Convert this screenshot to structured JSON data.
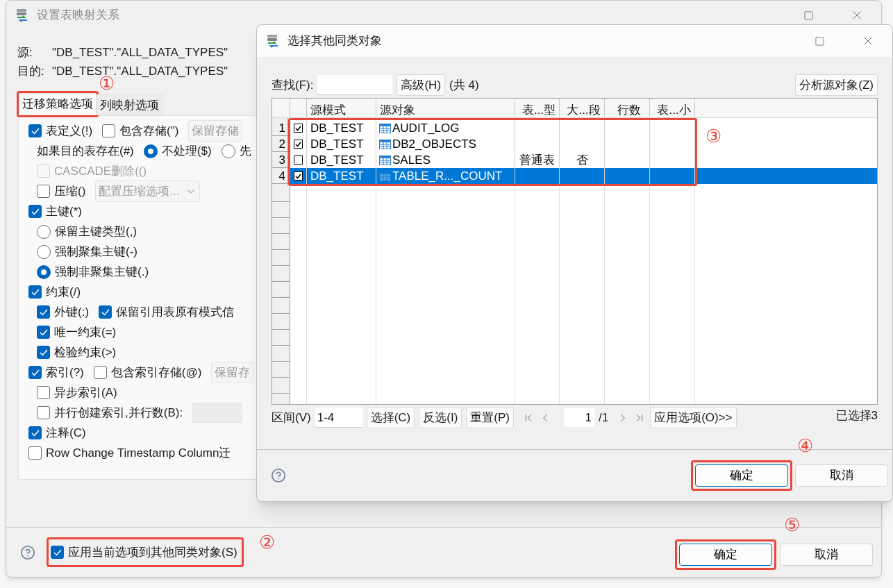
{
  "main_window": {
    "title": "设置表映射关系",
    "source_label": "源:",
    "source_value": "\"DB_TEST\".\"ALL_DATA_TYPES\"",
    "target_label": "目的:",
    "target_value": "\"DB_TEST\".\"ALL_DATA_TYPES\"",
    "tabs_callout": "①",
    "tabs": [
      {
        "label": "迁移策略选项",
        "selected": true
      },
      {
        "label": "列映射选项",
        "selected": false
      }
    ],
    "option_rows": [
      {
        "kind": "top",
        "items": [
          {
            "kind": "checkbox",
            "label": "表定义(!)",
            "checked": true,
            "disabled": false
          },
          {
            "kind": "checkbox",
            "label": "包含存储(\")",
            "checked": false,
            "disabled": false
          },
          {
            "kind": "select",
            "value": "保留存储",
            "disabled": true
          }
        ]
      },
      {
        "kind": "sub",
        "items": [
          {
            "kind": "text",
            "label": "如果目的表存在(#)"
          },
          {
            "kind": "radio",
            "label": "不处理($)",
            "selected": true
          },
          {
            "kind": "radio",
            "label": "先",
            "selected": false
          }
        ]
      },
      {
        "kind": "sub",
        "items": [
          {
            "kind": "checkbox",
            "label": "CASCADE删除(()",
            "checked": false,
            "disabled": true
          }
        ]
      },
      {
        "kind": "sub",
        "items": [
          {
            "kind": "checkbox",
            "label": "压缩()",
            "checked": false,
            "disabled": false
          },
          {
            "kind": "select",
            "value": "配置压缩选项...",
            "disabled": true,
            "caret": true
          }
        ]
      },
      {
        "kind": "top",
        "items": [
          {
            "kind": "checkbox",
            "label": "主键(*)",
            "checked": true,
            "disabled": false
          }
        ]
      },
      {
        "kind": "sub",
        "items": [
          {
            "kind": "radio",
            "label": "保留主键类型(,)",
            "selected": false
          }
        ]
      },
      {
        "kind": "sub",
        "items": [
          {
            "kind": "radio",
            "label": "强制聚集主键(-)",
            "selected": false
          }
        ]
      },
      {
        "kind": "sub",
        "items": [
          {
            "kind": "radio",
            "label": "强制非聚集主键(.)",
            "selected": true
          }
        ]
      },
      {
        "kind": "top",
        "items": [
          {
            "kind": "checkbox",
            "label": "约束(/)",
            "checked": true,
            "disabled": false
          }
        ]
      },
      {
        "kind": "sub",
        "items": [
          {
            "kind": "checkbox",
            "label": "外键(:)",
            "checked": true,
            "disabled": false
          },
          {
            "kind": "checkbox",
            "label": "保留引用表原有模式信",
            "checked": true,
            "disabled": false
          }
        ]
      },
      {
        "kind": "sub",
        "items": [
          {
            "kind": "checkbox",
            "label": "唯一约束(=)",
            "checked": true,
            "disabled": false
          }
        ]
      },
      {
        "kind": "sub",
        "items": [
          {
            "kind": "checkbox",
            "label": "检验约束(>)",
            "checked": true,
            "disabled": false
          }
        ]
      },
      {
        "kind": "top",
        "items": [
          {
            "kind": "checkbox",
            "label": "索引(?)",
            "checked": true,
            "disabled": false
          },
          {
            "kind": "checkbox",
            "label": "包含索引存储(@)",
            "checked": false,
            "disabled": false
          },
          {
            "kind": "select",
            "value": "保留存",
            "disabled": true
          }
        ]
      },
      {
        "kind": "sub",
        "items": [
          {
            "kind": "checkbox",
            "label": "异步索引(A)",
            "checked": false,
            "disabled": false
          }
        ]
      },
      {
        "kind": "sub",
        "items": [
          {
            "kind": "checkbox",
            "label": "并行创建索引,并行数(B):",
            "checked": false,
            "disabled": false
          },
          {
            "kind": "field",
            "disabled": true
          }
        ]
      },
      {
        "kind": "top",
        "items": [
          {
            "kind": "checkbox",
            "label": "注释(C)",
            "checked": true,
            "disabled": false
          }
        ]
      },
      {
        "kind": "top",
        "items": [
          {
            "kind": "checkbox",
            "label": "Row Change Timestamp Column迁",
            "checked": false,
            "disabled": false
          }
        ]
      }
    ],
    "apply_option": {
      "label": "应用当前选项到其他同类对象(S)",
      "checked": true,
      "callout": "②"
    },
    "buttons": [
      {
        "label": "确定",
        "default": true,
        "callout": "⑤"
      },
      {
        "label": "取消",
        "default": false
      }
    ]
  },
  "dialog": {
    "title": "选择其他同类对象",
    "find_label": "查找(F):",
    "advanced_button": "高级(H)",
    "total": "(共 4)",
    "analyze_button": "分析源对象(Z)",
    "table": {
      "callout": "③",
      "columns": [
        "源模式",
        "源对象",
        "表...型",
        "大...段",
        "行数",
        "表...小"
      ],
      "rows": [
        {
          "number": "1",
          "checked": true,
          "selected": false,
          "schema": "DB_TEST",
          "object": "AUDIT_LOG",
          "column_3": "",
          "column_4": ""
        },
        {
          "number": "2",
          "checked": true,
          "selected": false,
          "schema": "DB_TEST",
          "object": "DB2_OBJECTS",
          "column_3": "",
          "column_4": ""
        },
        {
          "number": "3",
          "checked": false,
          "selected": false,
          "schema": "DB_TEST",
          "object": "SALES",
          "column_3": "普通表",
          "column_4": "否"
        },
        {
          "number": "4",
          "checked": true,
          "selected": true,
          "schema": "DB_TEST",
          "object": "TABLE_R..._COUNT",
          "column_3": "",
          "column_4": ""
        }
      ]
    },
    "range_label": "区间(V)",
    "range_value": "1-4",
    "action_buttons": [
      "选择(C)",
      "反选(I)",
      "重置(P)"
    ],
    "page_value": "1",
    "page_total": "/1",
    "apply_options_button": "应用选项(O)>>",
    "selected_count": "已选择3",
    "buttons": [
      {
        "label": "确定",
        "default": true,
        "callout": "④"
      },
      {
        "label": "取消",
        "default": false
      }
    ]
  }
}
